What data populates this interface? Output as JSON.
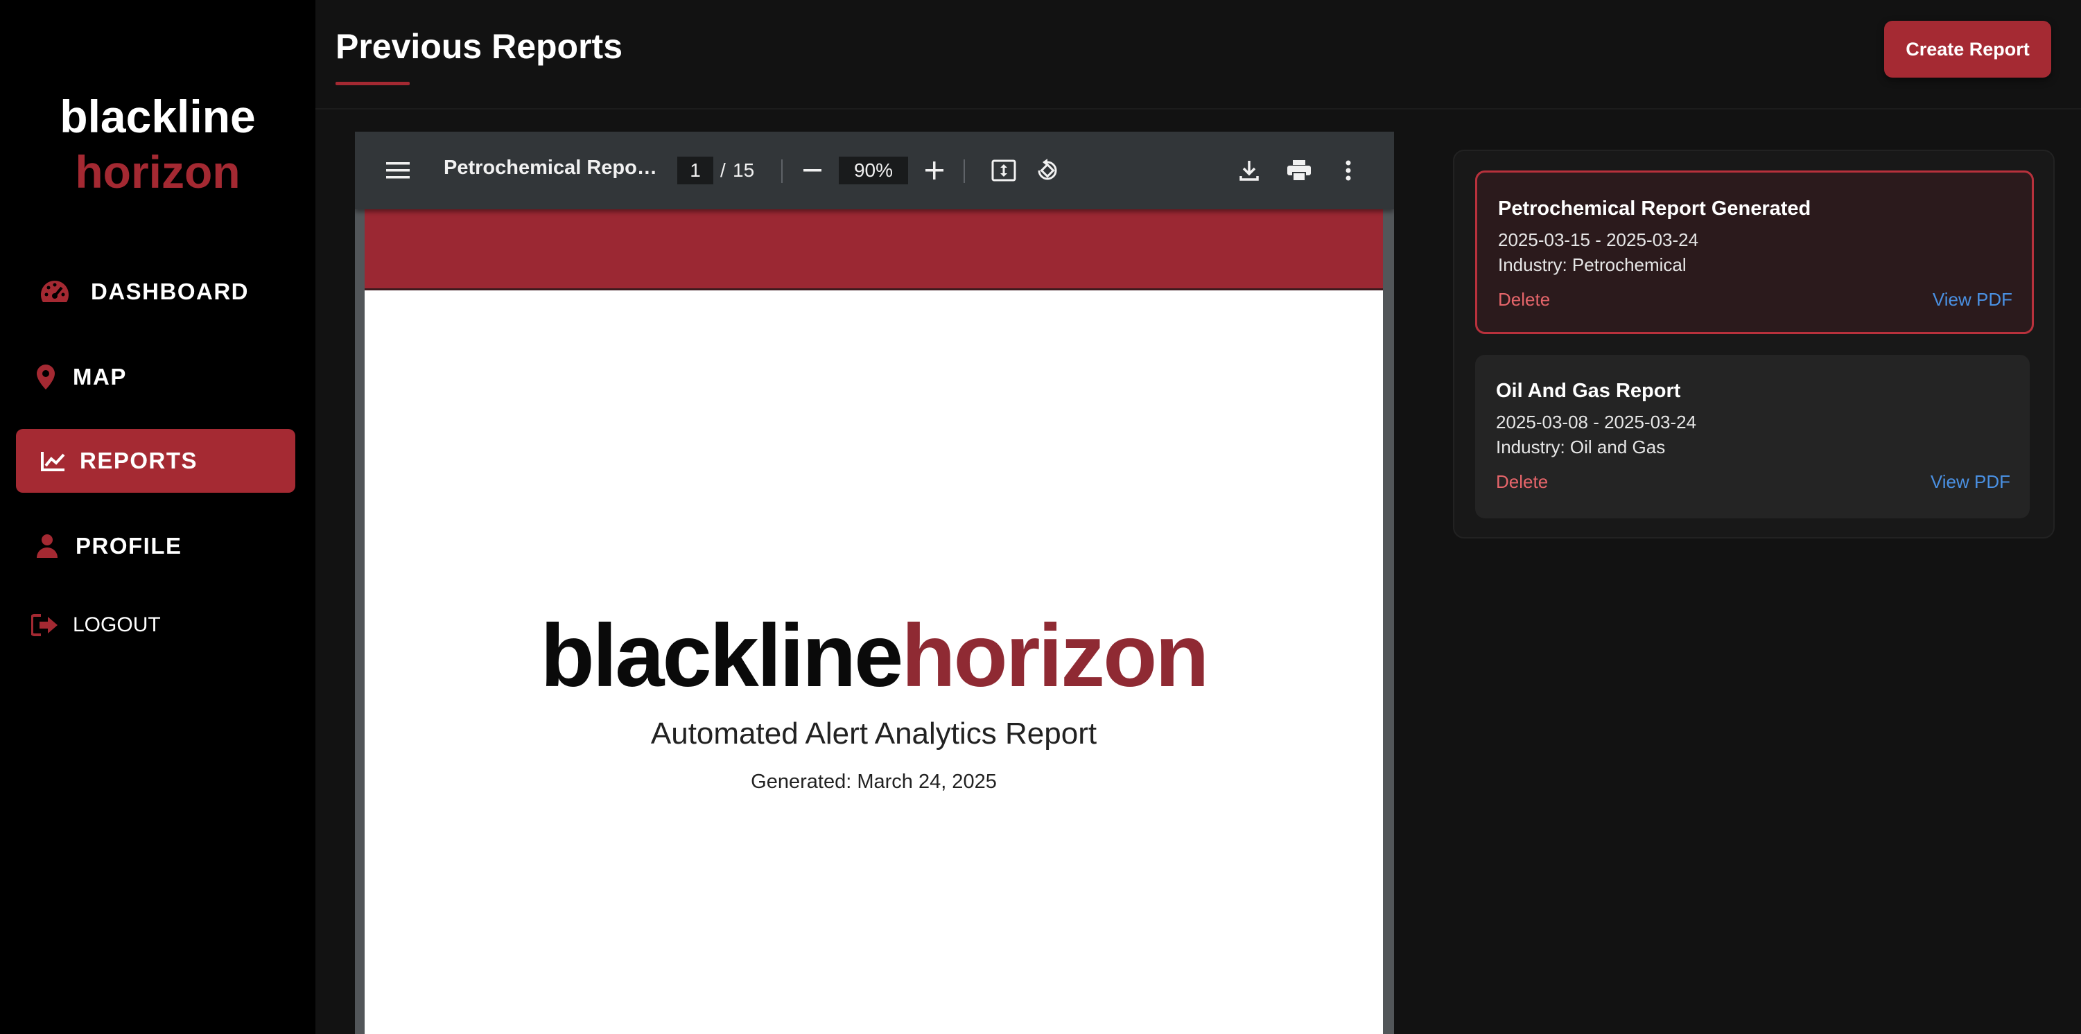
{
  "sidebar": {
    "logo_line1": "blackline",
    "logo_line2": "horizon",
    "items": [
      {
        "label": "DASHBOARD",
        "icon": "speedometer-icon"
      },
      {
        "label": "MAP",
        "icon": "map-pin-icon"
      },
      {
        "label": "REPORTS",
        "icon": "chart-line-icon",
        "active": true
      },
      {
        "label": "PROFILE",
        "icon": "user-icon"
      },
      {
        "label": "LOGOUT",
        "icon": "logout-icon"
      }
    ]
  },
  "header": {
    "title": "Previous Reports",
    "create_button": "Create Report"
  },
  "pdf": {
    "toolbar": {
      "title": "Petrochemical Report Generated",
      "current_page": "1",
      "page_separator": "/",
      "total_pages": "15",
      "zoom": "90%"
    },
    "page": {
      "logo_part1": "blackline",
      "logo_part2": "horizon",
      "subtitle": "Automated Alert Analytics Report",
      "generated": "Generated: March 24, 2025"
    }
  },
  "reports": [
    {
      "title": "Petrochemical Report Generated",
      "dates": "2025-03-15 - 2025-03-24",
      "industry": "Industry: Petrochemical",
      "delete_label": "Delete",
      "view_label": "View PDF",
      "selected": true
    },
    {
      "title": "Oil And Gas Report",
      "dates": "2025-03-08 - 2025-03-24",
      "industry": "Industry: Oil and Gas",
      "delete_label": "Delete",
      "view_label": "View PDF",
      "selected": false
    }
  ],
  "colors": {
    "accent": "#a52a33",
    "link": "#4a90e2",
    "delete": "#e5656a",
    "background": "#121212",
    "sidebar": "#000000"
  }
}
